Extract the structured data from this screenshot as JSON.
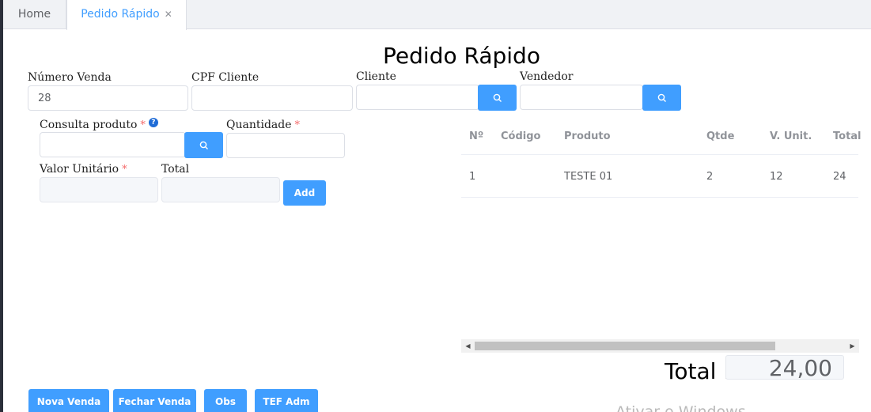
{
  "tabs": {
    "home": "Home",
    "active": "Pedido Rápido",
    "close_glyph": "✕"
  },
  "page": {
    "title": "Pedido Rápido"
  },
  "form": {
    "numero_venda": {
      "label": "Número Venda",
      "value": "28"
    },
    "cpf_cliente": {
      "label": "CPF Cliente",
      "value": ""
    },
    "cliente": {
      "label": "Cliente",
      "value": ""
    },
    "vendedor": {
      "label": "Vendedor",
      "value": ""
    },
    "consulta_produto": {
      "label": "Consulta produto",
      "required": "*",
      "help": "?",
      "value": ""
    },
    "quantidade": {
      "label": "Quantidade",
      "required": "*",
      "value": ""
    },
    "valor_unitario": {
      "label": "Valor Unitário",
      "required": "*",
      "value": ""
    },
    "total": {
      "label": "Total",
      "value": ""
    },
    "add_button": "Add"
  },
  "table": {
    "headers": [
      "Nº",
      "Código",
      "Produto",
      "Qtde",
      "V. Unit.",
      "Total"
    ],
    "rows": [
      {
        "n": "1",
        "codigo": "",
        "produto": "TESTE 01",
        "qtde": "2",
        "vunit": "12",
        "total": "24"
      }
    ]
  },
  "summary": {
    "label": "Total :",
    "value": "24,00"
  },
  "actions": {
    "nova_venda": "Nova Venda",
    "fechar_venda": "Fechar Venda",
    "obs": "Obs",
    "tef_adm": "TEF Adm"
  },
  "watermark": "Ativar o Windows",
  "icons": {
    "search": "search-icon",
    "close": "close-icon",
    "help": "help-icon"
  },
  "colors": {
    "primary": "#409eff",
    "required": "#f56c6c",
    "help": "#1e6bd6"
  }
}
